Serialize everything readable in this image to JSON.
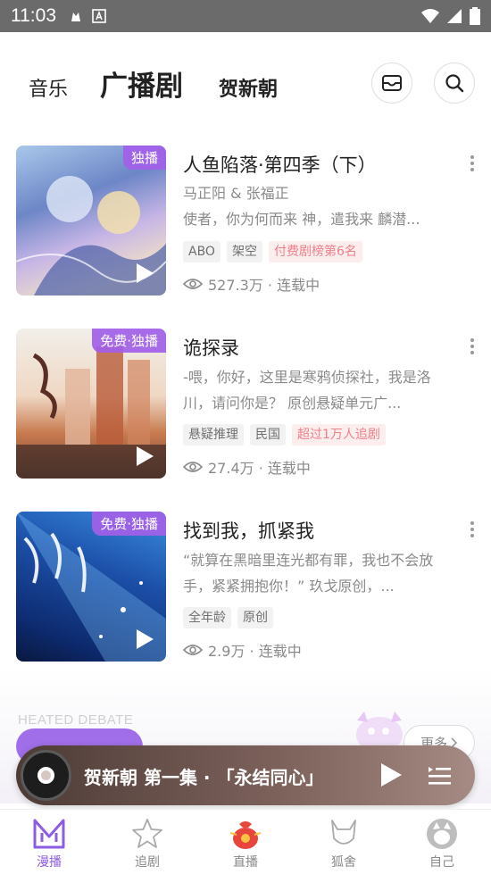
{
  "status_bar": {
    "time": "11:03"
  },
  "top_nav": {
    "tabs": [
      {
        "label": "音乐"
      },
      {
        "label": "广播剧"
      },
      {
        "label": "贺新朝"
      }
    ]
  },
  "feed": [
    {
      "badge": "独播",
      "title": "人鱼陷落·第四季（下）",
      "author": "马正阳 & 张福正",
      "description": "使者，你为何而来 神，遣我来  麟潜...",
      "tags": [
        "ABO",
        "架空"
      ],
      "highlight_tag": "付费剧榜第6名",
      "stats": "527.3万 · 连载中"
    },
    {
      "badge": "免费·独播",
      "title": "诡探录",
      "author": "",
      "description": "-喂，你好，这里是寒鸦侦探社，我是洛川，请问你是？  原创悬疑单元广...",
      "tags": [
        "悬疑推理",
        "民国"
      ],
      "highlight_tag": "超过1万人追剧",
      "stats": "27.4万 · 连载中"
    },
    {
      "badge": "免费·独播",
      "title": "找到我，抓紧我",
      "author": "",
      "description": "“就算在黑暗里连光都有罪，我也不会放手，紧紧拥抱你！”  玖戈原创，...",
      "tags": [
        "全年龄",
        "原创"
      ],
      "highlight_tag": "",
      "stats": "2.9万 · 连载中"
    }
  ],
  "section": {
    "heading": "HEATED DEBATE",
    "more_label": "更多"
  },
  "mini_player": {
    "title": "贺新朝 第一集 · 「永结同心」"
  },
  "bottom_nav": [
    {
      "label": "漫播",
      "active": true
    },
    {
      "label": "追剧",
      "active": false
    },
    {
      "label": "直播",
      "active": false
    },
    {
      "label": "狐舍",
      "active": false
    },
    {
      "label": "自己",
      "active": false
    }
  ],
  "colors": {
    "accent": "#8c5ce3",
    "badge": "#a260e8",
    "highlight_tag": "#f07f8a"
  }
}
